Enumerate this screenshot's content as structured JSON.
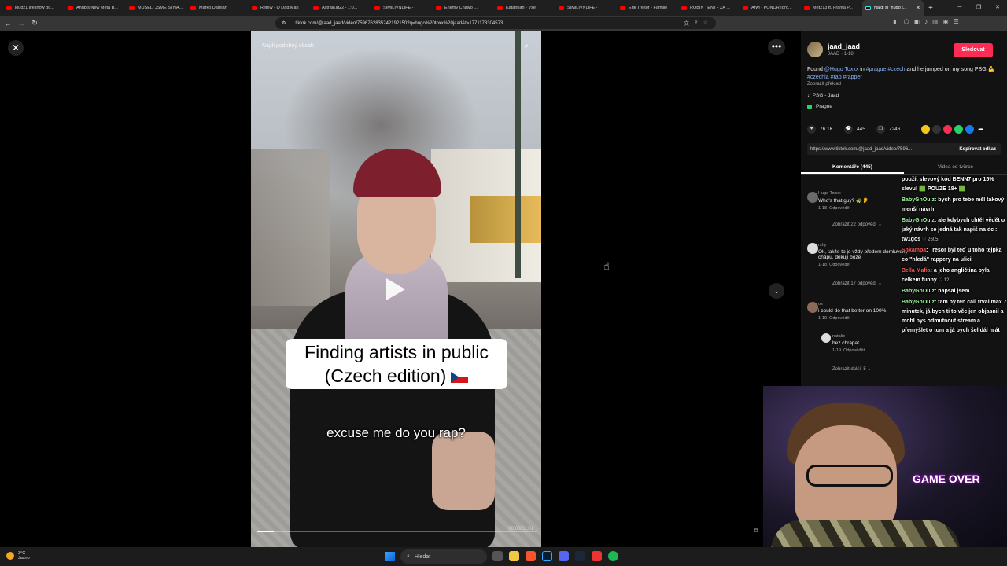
{
  "browser": {
    "tabs": [
      {
        "label": "loudz1 lifeshow bo..."
      },
      {
        "label": "Anubis New Meta B..."
      },
      {
        "label": "MUSELI JSME SI NA..."
      },
      {
        "label": "Marko Damian"
      },
      {
        "label": "Refew - O Dad Man"
      },
      {
        "label": "AstralKid22 - 1:0..."
      },
      {
        "label": "SIMILIVNLIFE -"
      },
      {
        "label": "Enemy Chawo ..."
      },
      {
        "label": "Katannah - Vše"
      },
      {
        "label": "SIMILIVNLIFE -"
      },
      {
        "label": "Erik Tresor - Familie"
      },
      {
        "label": "ROBIN TENT - ZA ..."
      },
      {
        "label": "Arwi - PONOR (pro..."
      },
      {
        "label": "Met213 ft. Franta P..."
      },
      {
        "label": "Najdi si \"hugo t..."
      }
    ],
    "url": "tiktok.com/@jaad_jaad/video/7596762835242192150?q=hugo%20toxx%20jaad&t=1771178304573"
  },
  "video": {
    "search_placeholder": "Najdi podobný obsah",
    "caption_line1": "Finding artists in public",
    "caption_line2": "(Czech edition)",
    "subtitle": "excuse me do you rap?",
    "progress": 0.06,
    "timecode": "00:00/01:01"
  },
  "sidebar": {
    "author_name": "jaad_jaad",
    "author_sub": "JAAD · 1-18",
    "follow_label": "Sledovat",
    "desc_text1": "Found ",
    "desc_mention": "@Hugo Toxxx",
    "desc_text2": " in ",
    "desc_tags1": "#prague #czech",
    "desc_text3": " and he jumped on my song PSG 💪 ",
    "desc_tags2": "#czechia #rap #rapper",
    "translate_label": "Zobrazit překlad",
    "music": "PSG - Jaad",
    "place": "Prague",
    "likes": "76.1K",
    "comments_count": "445",
    "saves": "7246",
    "link": "https://www.tiktok.com/@jaad_jaad/video/7596...",
    "copy_label": "Kopírovat odkaz",
    "tab_comments": "Komentáře (445)",
    "tab_creator": "Videa od tvůrce",
    "comments": [
      {
        "user": "Hugo Toxxx",
        "text": "Who's that guy? 🐢👂",
        "date": "1-18",
        "reply": "Odpovědět",
        "more": "Zobrazit 22 odpovědí ⌄"
      },
      {
        "user": "rshy",
        "text": "Ok, takže to je vždy předem domluvený chápu, děkuji boze",
        "date": "1-18",
        "reply": "Odpovědět",
        "more": "Zobrazit 17 odpovědí ⌄"
      },
      {
        "user": "os",
        "text": "i could do that better on 100%",
        "date": "1-19",
        "reply": "Odpovědět"
      },
      {
        "user": "natalie",
        "text": "bez chrapat",
        "date": "1-19",
        "reply": "Odpovědět",
        "more": "Zobrazit další: 5 ⌄"
      }
    ]
  },
  "chat": [
    {
      "name": "",
      "text": "použít slevový kód BENN7 pro 15% slevu! 🟩 POUZE 18+ 🟩",
      "sub": ""
    },
    {
      "name": "BabyGhOulz",
      "text": ": bych pro tebe měl takový menší návrh",
      "sub": ""
    },
    {
      "name": "BabyGhOulz",
      "text": ": ale kdybych chtěl vědět o jaký návrh se jedná tak napiš na dc : tw1gos",
      "sub": "♡ 2605"
    },
    {
      "name": "Shkampa",
      "text": ": Tresor byl teď u toho tejpka co \"hledá\" rappery na ulici",
      "sub": ""
    },
    {
      "name": "Bella Mafia",
      "text": ": a jeho angličtina byla celkem funny",
      "sub": "♡ 12"
    },
    {
      "name": "BabyGhOulz",
      "text": ": napsal jsem",
      "sub": ""
    },
    {
      "name": "BabyGhOulz",
      "text": ": tam by ten call trval max 7 minutek, já bych ti to věc jen objasnil a mohl bys odmutnout stream a přemýšlet o tom a já bych šel dál hrát",
      "sub": ""
    }
  ],
  "webcam": {
    "overlay": "GAME OVER"
  },
  "taskbar": {
    "temp": "3°C",
    "weather": "Jasno",
    "search": "Hledat"
  }
}
